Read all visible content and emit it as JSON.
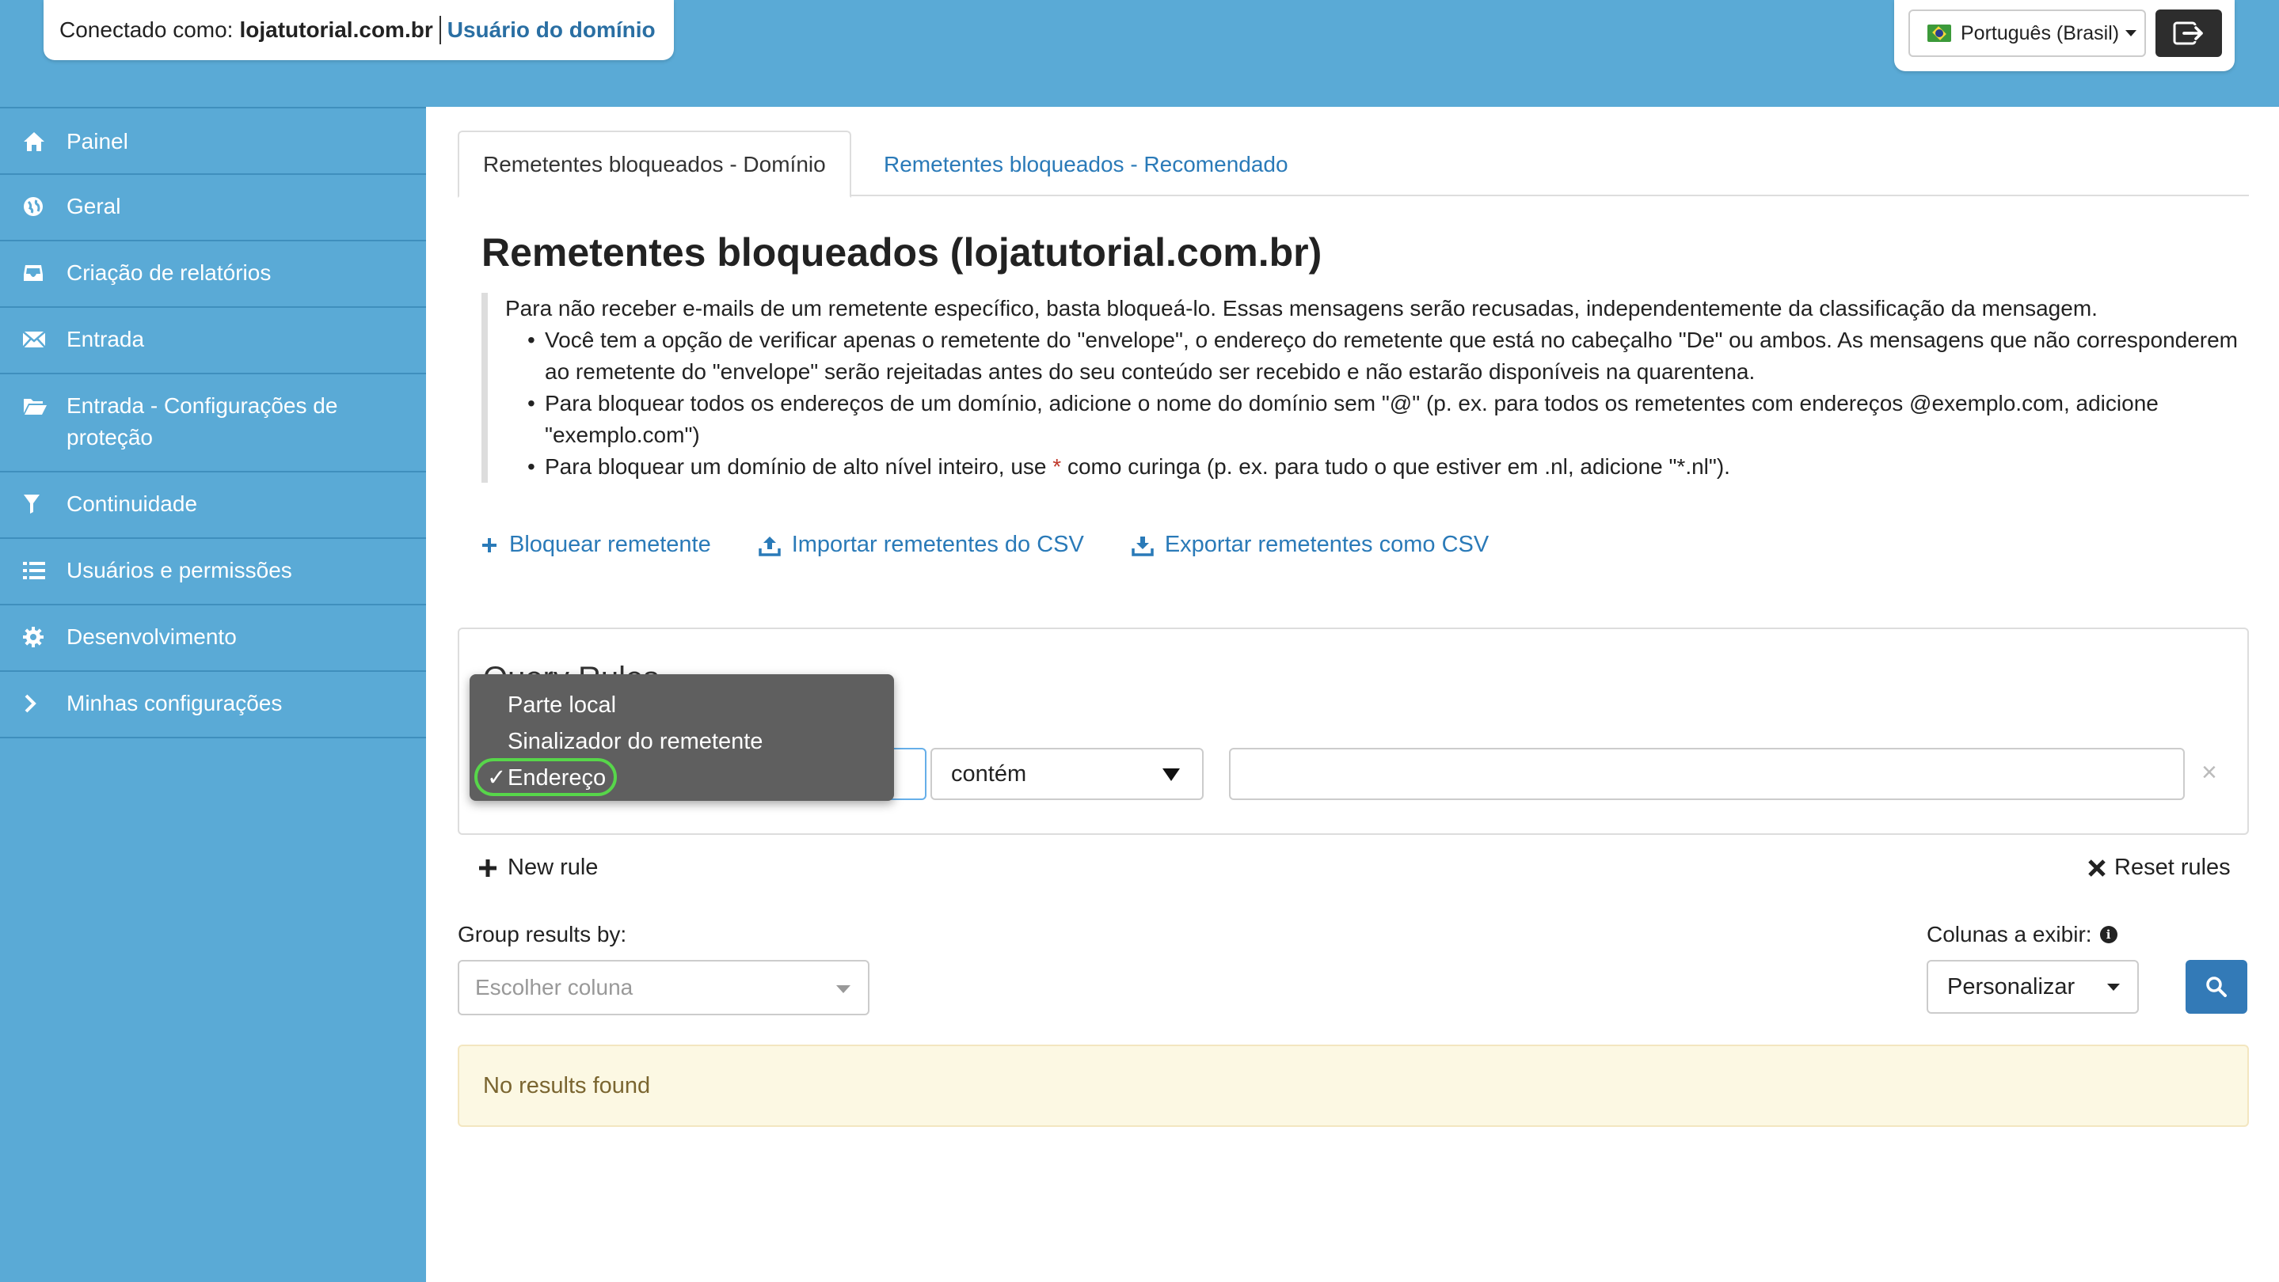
{
  "header": {
    "connected_label": "Conectado como:",
    "domain": "lojatutorial.com.br",
    "role_link": "Usuário do domínio",
    "language": "Português (Brasil)"
  },
  "sidebar": {
    "items": [
      {
        "label": "Painel",
        "icon": "home-icon"
      },
      {
        "label": "Geral",
        "icon": "globe-icon"
      },
      {
        "label": "Criação de relatórios",
        "icon": "inbox-icon"
      },
      {
        "label": "Entrada",
        "icon": "envelope-icon"
      },
      {
        "label": "Entrada - Configurações de proteção",
        "icon": "folder-open-icon"
      },
      {
        "label": "Continuidade",
        "icon": "filter-icon"
      },
      {
        "label": "Usuários e permissões",
        "icon": "list-icon"
      },
      {
        "label": "Desenvolvimento",
        "icon": "gear-icon"
      },
      {
        "label": "Minhas configurações",
        "icon": "chevron-right-icon"
      }
    ]
  },
  "tabs": [
    {
      "label": "Remetentes bloqueados - Domínio",
      "active": true
    },
    {
      "label": "Remetentes bloqueados - Recomendado",
      "active": false
    }
  ],
  "page": {
    "title": "Remetentes bloqueados (lojatutorial.com.br)",
    "intro": "Para não receber e-mails de um remetente específico, basta bloqueá-lo. Essas mensagens serão recusadas, independentemente da classificação da mensagem.",
    "bullet1": "Você tem a opção de verificar apenas o remetente do \"envelope\", o endereço do remetente que está no cabeçalho \"De\" ou ambos. As mensagens que não corresponderem ao remetente do \"envelope\" serão rejeitadas antes do seu conteúdo ser recebido e não estarão disponíveis na quarentena.",
    "bullet2": "Para bloquear todos os endereços de um domínio, adicione o nome do domínio sem \"@\" (p. ex. para todos os remetentes com endereços @exemplo.com, adicione \"exemplo.com\")",
    "bullet3_pre": "Para bloquear um domínio de alto nível inteiro, use",
    "bullet3_wild": "*",
    "bullet3_post": "como curinga (p. ex. para tudo o que estiver em .nl, adicione \"*.nl\")."
  },
  "actions": {
    "block": "Bloquear remetente",
    "import": "Importar remetentes do CSV",
    "export": "Exportar remetentes como CSV"
  },
  "query": {
    "title": "Query Rules",
    "field_options": [
      "Parte local",
      "Sinalizador do remetente",
      "Endereço"
    ],
    "field_selected": "Endereço",
    "check": "✓",
    "operator": "contém",
    "value": "",
    "remove": "×",
    "new_rule": "New rule",
    "reset_rules": "Reset rules"
  },
  "grouping": {
    "label": "Group results by:",
    "placeholder": "Escolher coluna"
  },
  "columns": {
    "label": "Colunas a exibir:",
    "selected": "Personalizar"
  },
  "results": {
    "message": "No results found"
  },
  "colors": {
    "accent_blue": "#5aaad6",
    "link_blue": "#2a7ab8",
    "primary_button": "#337ab7",
    "highlight_green": "#57d64a",
    "warning_bg": "#fcf8e3"
  }
}
